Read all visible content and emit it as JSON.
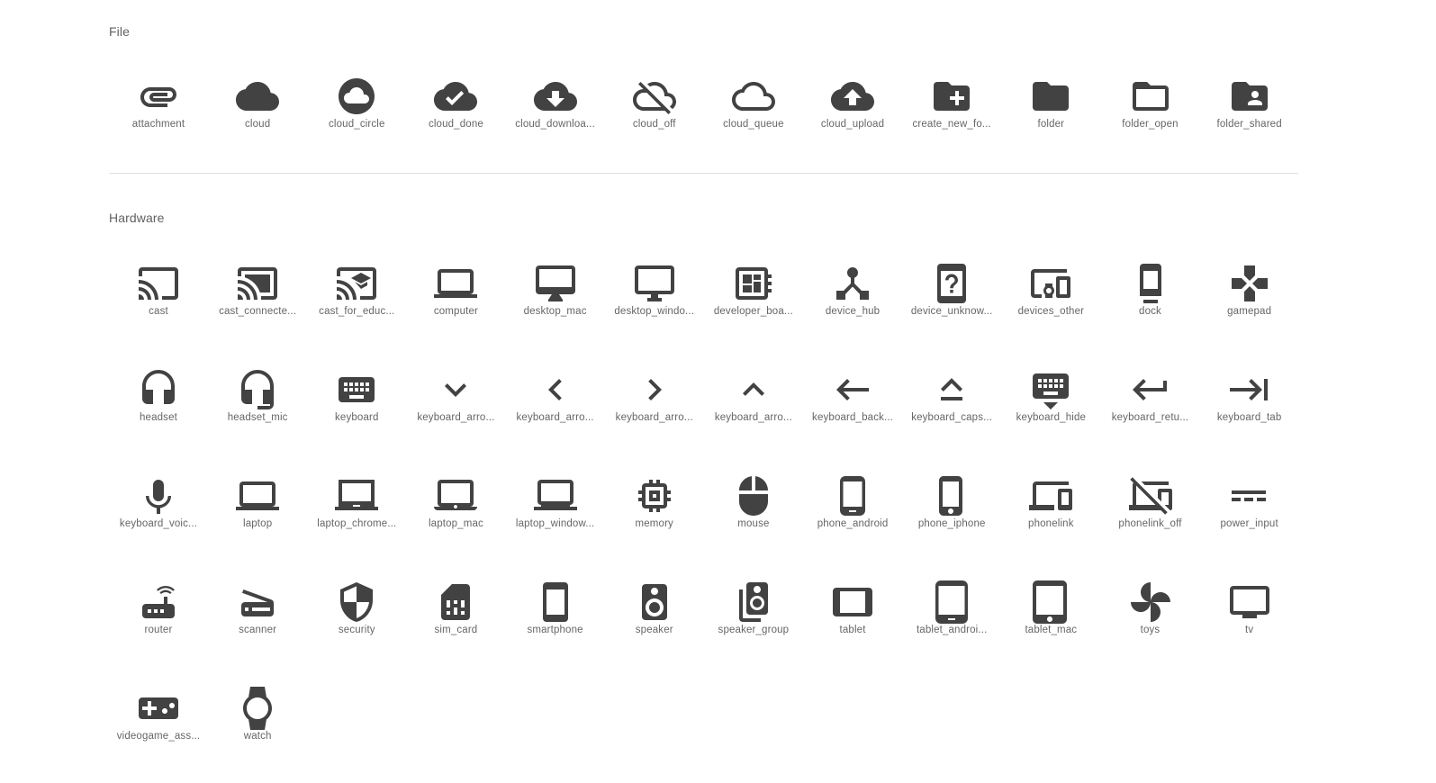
{
  "sections": {
    "file": {
      "title": "File",
      "icons": [
        {
          "label": "attachment",
          "icon": "attachment-icon"
        },
        {
          "label": "cloud",
          "icon": "cloud-icon"
        },
        {
          "label": "cloud_circle",
          "icon": "cloud-circle-icon"
        },
        {
          "label": "cloud_done",
          "icon": "cloud-done-icon"
        },
        {
          "label": "cloud_downloa...",
          "icon": "cloud-download-icon"
        },
        {
          "label": "cloud_off",
          "icon": "cloud-off-icon"
        },
        {
          "label": "cloud_queue",
          "icon": "cloud-queue-icon"
        },
        {
          "label": "cloud_upload",
          "icon": "cloud-upload-icon"
        },
        {
          "label": "create_new_fo...",
          "icon": "create-new-folder-icon"
        },
        {
          "label": "folder",
          "icon": "folder-icon"
        },
        {
          "label": "folder_open",
          "icon": "folder-open-icon"
        },
        {
          "label": "folder_shared",
          "icon": "folder-shared-icon"
        }
      ]
    },
    "hardware": {
      "title": "Hardware",
      "icons": [
        {
          "label": "cast",
          "icon": "cast-icon"
        },
        {
          "label": "cast_connecte...",
          "icon": "cast-connected-icon"
        },
        {
          "label": "cast_for_educ...",
          "icon": "cast-for-education-icon"
        },
        {
          "label": "computer",
          "icon": "computer-icon"
        },
        {
          "label": "desktop_mac",
          "icon": "desktop-mac-icon"
        },
        {
          "label": "desktop_windo...",
          "icon": "desktop-windows-icon"
        },
        {
          "label": "developer_boa...",
          "icon": "developer-board-icon"
        },
        {
          "label": "device_hub",
          "icon": "device-hub-icon"
        },
        {
          "label": "device_unknow...",
          "icon": "device-unknown-icon"
        },
        {
          "label": "devices_other",
          "icon": "devices-other-icon"
        },
        {
          "label": "dock",
          "icon": "dock-icon"
        },
        {
          "label": "gamepad",
          "icon": "gamepad-icon"
        },
        {
          "label": "headset",
          "icon": "headset-icon"
        },
        {
          "label": "headset_mic",
          "icon": "headset-mic-icon"
        },
        {
          "label": "keyboard",
          "icon": "keyboard-icon"
        },
        {
          "label": "keyboard_arro...",
          "icon": "keyboard-arrow-down-icon"
        },
        {
          "label": "keyboard_arro...",
          "icon": "keyboard-arrow-left-icon"
        },
        {
          "label": "keyboard_arro...",
          "icon": "keyboard-arrow-right-icon"
        },
        {
          "label": "keyboard_arro...",
          "icon": "keyboard-arrow-up-icon"
        },
        {
          "label": "keyboard_back...",
          "icon": "keyboard-backspace-icon"
        },
        {
          "label": "keyboard_caps...",
          "icon": "keyboard-capslock-icon"
        },
        {
          "label": "keyboard_hide",
          "icon": "keyboard-hide-icon"
        },
        {
          "label": "keyboard_retu...",
          "icon": "keyboard-return-icon"
        },
        {
          "label": "keyboard_tab",
          "icon": "keyboard-tab-icon"
        },
        {
          "label": "keyboard_voic...",
          "icon": "keyboard-voice-icon"
        },
        {
          "label": "laptop",
          "icon": "laptop-icon"
        },
        {
          "label": "laptop_chrome...",
          "icon": "laptop-chromebook-icon"
        },
        {
          "label": "laptop_mac",
          "icon": "laptop-mac-icon"
        },
        {
          "label": "laptop_window...",
          "icon": "laptop-windows-icon"
        },
        {
          "label": "memory",
          "icon": "memory-icon"
        },
        {
          "label": "mouse",
          "icon": "mouse-icon"
        },
        {
          "label": "phone_android",
          "icon": "phone-android-icon"
        },
        {
          "label": "phone_iphone",
          "icon": "phone-iphone-icon"
        },
        {
          "label": "phonelink",
          "icon": "phonelink-icon"
        },
        {
          "label": "phonelink_off",
          "icon": "phonelink-off-icon"
        },
        {
          "label": "power_input",
          "icon": "power-input-icon"
        },
        {
          "label": "router",
          "icon": "router-icon"
        },
        {
          "label": "scanner",
          "icon": "scanner-icon"
        },
        {
          "label": "security",
          "icon": "security-icon"
        },
        {
          "label": "sim_card",
          "icon": "sim-card-icon"
        },
        {
          "label": "smartphone",
          "icon": "smartphone-icon"
        },
        {
          "label": "speaker",
          "icon": "speaker-icon"
        },
        {
          "label": "speaker_group",
          "icon": "speaker-group-icon"
        },
        {
          "label": "tablet",
          "icon": "tablet-icon"
        },
        {
          "label": "tablet_androi...",
          "icon": "tablet-android-icon"
        },
        {
          "label": "tablet_mac",
          "icon": "tablet-mac-icon"
        },
        {
          "label": "toys",
          "icon": "toys-icon"
        },
        {
          "label": "tv",
          "icon": "tv-icon"
        },
        {
          "label": "videogame_ass...",
          "icon": "videogame-asset-icon"
        },
        {
          "label": "watch",
          "icon": "watch-icon"
        }
      ]
    }
  },
  "colors": {
    "icon": "#424242",
    "label": "#666666",
    "divider": "#e0e0e0",
    "background": "#ffffff"
  }
}
